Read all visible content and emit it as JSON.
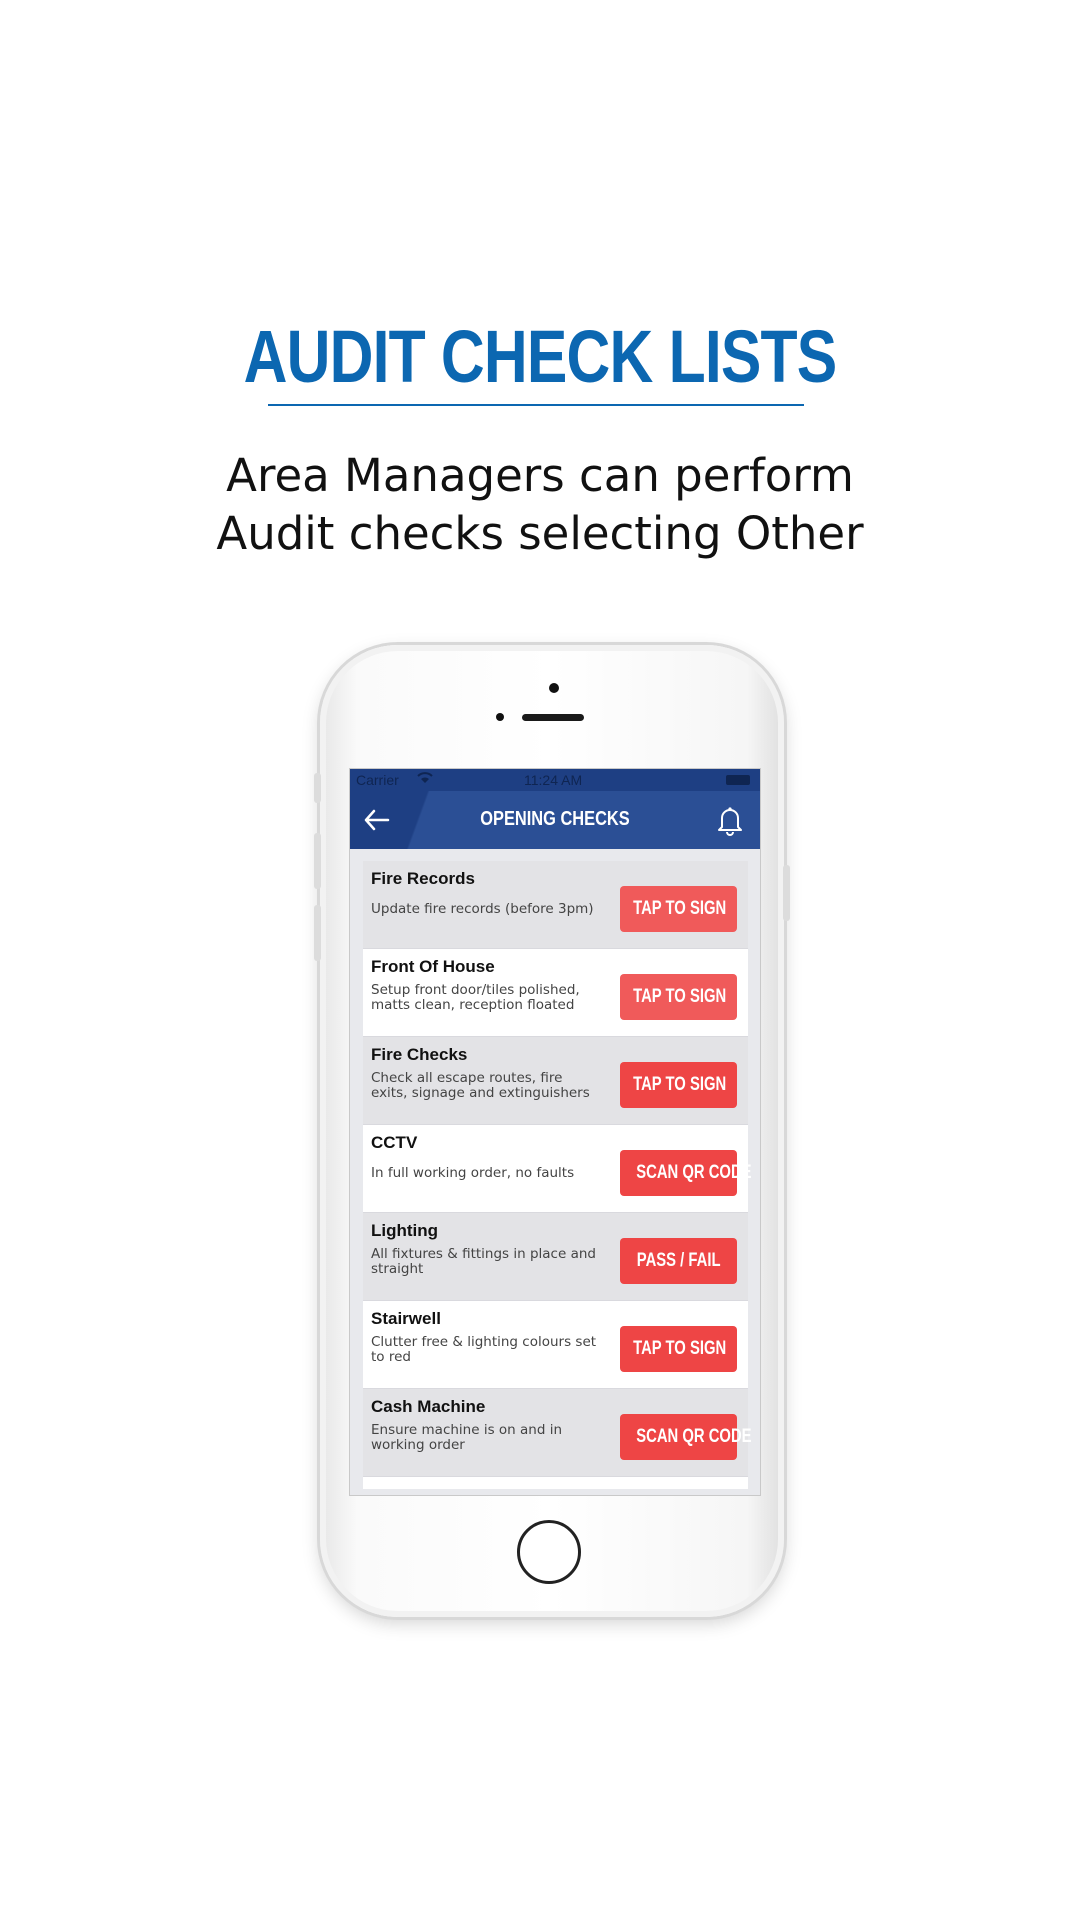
{
  "headline": "AUDIT CHECK LISTS",
  "subtitle_line1": "Area Managers can perform",
  "subtitle_line2": "Audit checks selecting Other",
  "phone": {
    "status": {
      "carrier": "Carrier",
      "time": "11:24 AM"
    },
    "nav": {
      "title": "OPENING CHECKS",
      "back_icon": "arrow-left-icon",
      "bell_icon": "bell-icon"
    },
    "items": [
      {
        "title": "Fire Records",
        "desc": "Update fire records (before 3pm)",
        "button": "TAP TO SIGN"
      },
      {
        "title": "Front Of House",
        "desc": "Setup front door/tiles polished, matts clean, reception floated",
        "button": "TAP TO SIGN"
      },
      {
        "title": "Fire Checks",
        "desc": "Check all escape routes, fire exits, signage and extinguishers",
        "button": "TAP TO SIGN"
      },
      {
        "title": "CCTV",
        "desc": "In full working order, no faults",
        "button": "SCAN QR CODE"
      },
      {
        "title": "Lighting",
        "desc": "All fixtures & fittings in place and straight",
        "button": "PASS / FAIL"
      },
      {
        "title": "Stairwell",
        "desc": "Clutter free & lighting colours set to red",
        "button": "TAP TO SIGN"
      },
      {
        "title": "Cash Machine",
        "desc": "Ensure machine is on and in working order",
        "button": "SCAN QR CODE"
      }
    ]
  },
  "colors": {
    "headline": "#0c67b1",
    "navbar": "#2b4f95",
    "button": "#ee4545"
  }
}
